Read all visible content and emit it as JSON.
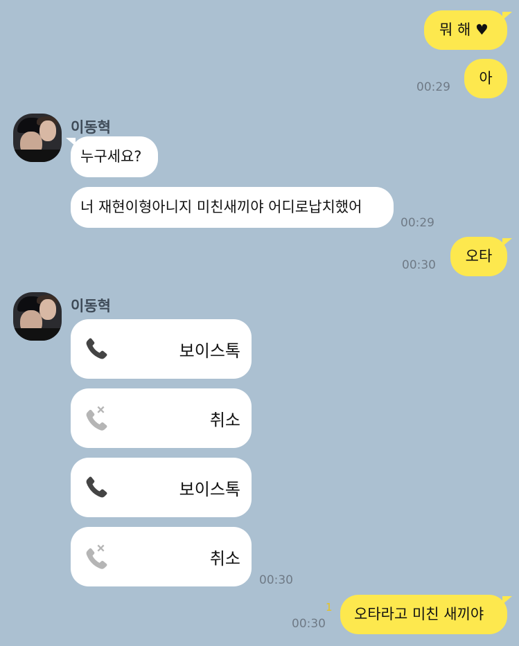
{
  "chat": {
    "contact_name": "이동혁",
    "messages": [
      {
        "sender": "me",
        "text": "뭐 해 ♥"
      },
      {
        "sender": "me",
        "text": "아",
        "time": "00:29"
      },
      {
        "sender": "them",
        "text": "누구세요?"
      },
      {
        "sender": "them",
        "text": "너 재현이형아니지 미친새끼야 어디로납치했어",
        "time": "00:29"
      },
      {
        "sender": "me",
        "text": "오타",
        "time": "00:30"
      },
      {
        "sender": "them",
        "type": "call",
        "label": "보이스톡",
        "icon": "phone-icon"
      },
      {
        "sender": "them",
        "type": "call",
        "label": "취소",
        "icon": "phone-missed-icon"
      },
      {
        "sender": "them",
        "type": "call",
        "label": "보이스톡",
        "icon": "phone-icon"
      },
      {
        "sender": "them",
        "type": "call",
        "label": "취소",
        "icon": "phone-missed-icon",
        "time": "00:30"
      },
      {
        "sender": "me",
        "text": "오타라고 미친 새끼야",
        "time": "00:30",
        "unread": "1"
      }
    ]
  },
  "colors": {
    "background": "#abc0d1",
    "my_bubble": "#fde84e",
    "their_bubble": "#ffffff",
    "unread": "#e8c21a"
  }
}
